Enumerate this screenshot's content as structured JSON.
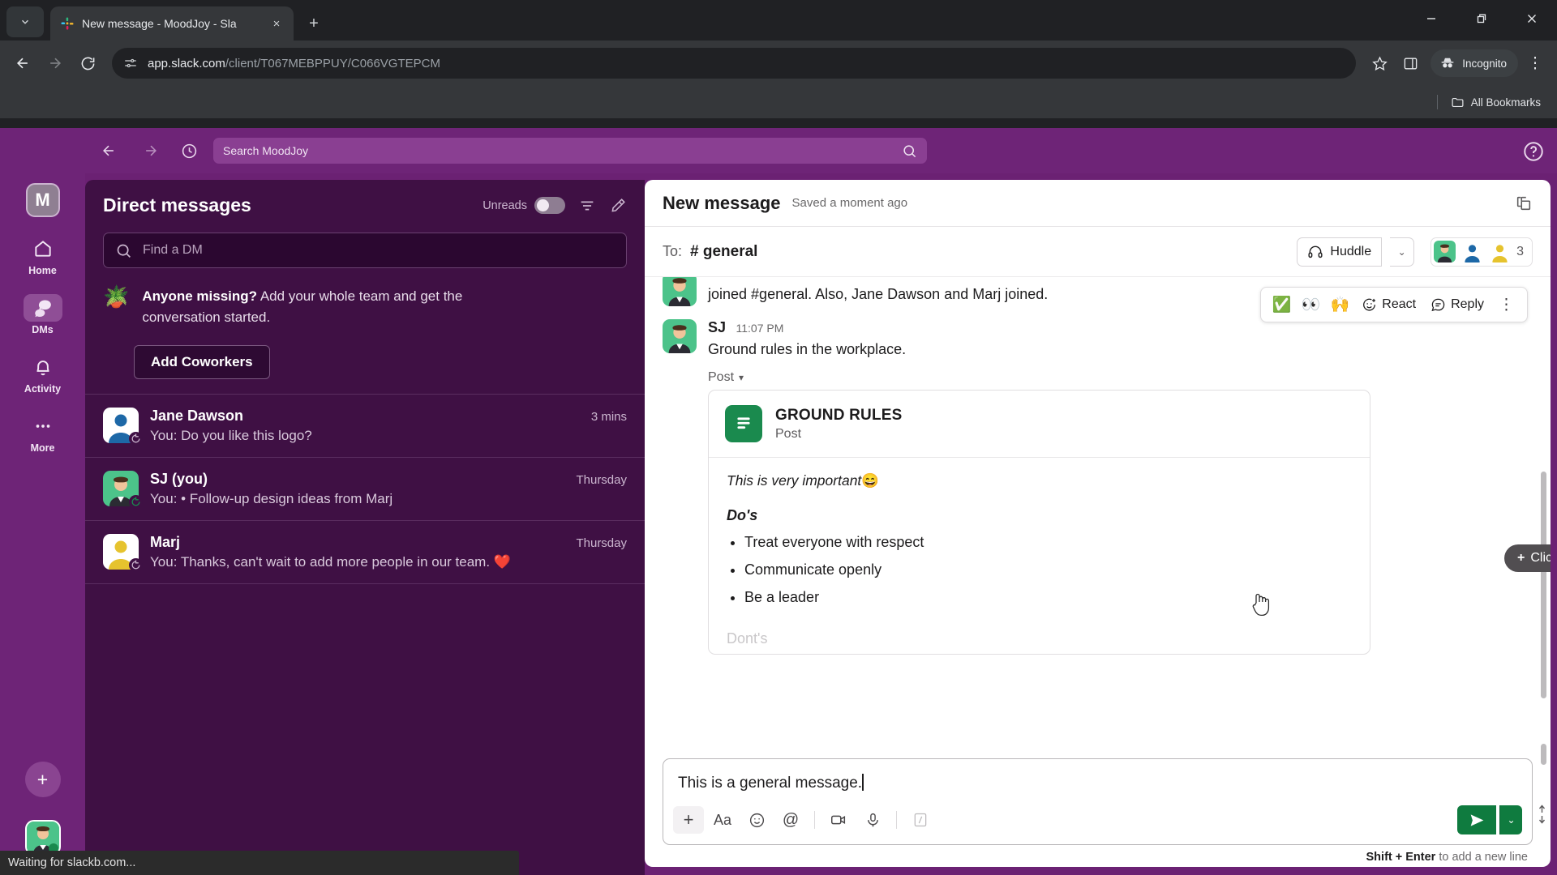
{
  "browser": {
    "tab": {
      "title": "New message - MoodJoy - Sla",
      "favicon": "slack-icon",
      "close": "×"
    },
    "tab_list_icon": "chevron-down-icon",
    "new_tab": "+",
    "window_controls": {
      "minimize": "—",
      "maximize": "❐",
      "close": "✕"
    },
    "nav": {
      "back": "←",
      "forward": "→",
      "reload": "↻"
    },
    "url_host": "app.slack.com",
    "url_path": "/client/T067MEBPPUY/C066VGTEPCM",
    "bookmark_star": "☆",
    "side_panel_icon": "side-panel-icon",
    "incognito_label": "Incognito",
    "menu_icon": "⋮",
    "bookmarks_label": "All Bookmarks"
  },
  "status_bar": {
    "text": "Waiting for slackb.com..."
  },
  "slack": {
    "topbar": {
      "back": "←",
      "forward": "→",
      "history_icon": "clock-icon",
      "search_placeholder": "Search MoodJoy",
      "search_icon": "search-icon",
      "help_icon": "help-circle-icon"
    },
    "rail": {
      "workspace_initial": "M",
      "items": [
        {
          "label": "Home",
          "icon": "home-icon",
          "active": false
        },
        {
          "label": "DMs",
          "icon": "dms-icon",
          "active": true
        },
        {
          "label": "Activity",
          "icon": "bell-icon",
          "active": false
        },
        {
          "label": "More",
          "icon": "ellipsis-icon",
          "active": false
        }
      ],
      "add_label": "+",
      "avatar": "user-avatar"
    },
    "sidebar": {
      "title": "Direct messages",
      "unreads_label": "Unreads",
      "unreads_on": false,
      "filter_icon": "filter-icon",
      "compose_icon": "compose-icon",
      "search_placeholder": "Find a DM",
      "promo": {
        "emoji": "🪴",
        "bold": "Anyone missing?",
        "rest": " Add your whole team and get the conversation started.",
        "button": "Add Coworkers"
      },
      "dms": [
        {
          "name": "Jane Dawson",
          "preview": "You: Do you like this logo?",
          "time": "3 mins",
          "avatar_color": "#1d68a7",
          "avatar_bg": "#ffffff"
        },
        {
          "name": "SJ (you)",
          "preview": "You: • Follow-up design ideas from Marj",
          "time": "Thursday",
          "avatar_color": "#3b2b1d",
          "avatar_bg": "#4cc38a"
        },
        {
          "name": "Marj",
          "preview": "You: Thanks, can't wait to add more people in our team. ❤️",
          "time": "Thursday",
          "avatar_color": "#e6c32e",
          "avatar_bg": "#ffffff"
        }
      ]
    },
    "main": {
      "header": {
        "title": "New message",
        "subtitle": "Saved a moment ago",
        "expand_icon": "open-in-new-icon"
      },
      "to_row": {
        "to_label": "To:",
        "channel": "# general",
        "huddle_label": "Huddle",
        "huddle_icon": "headphones-icon",
        "huddle_caret": "⌄",
        "member_count": "3"
      },
      "messages": [
        {
          "name": "",
          "time": "",
          "text": "joined #general. Also, Jane Dawson and Marj joined.",
          "clipped": true
        },
        {
          "name": "SJ",
          "time": "11:07 PM",
          "text": "Ground rules in the workplace.",
          "clipped": false
        }
      ],
      "hover_toolbar": {
        "emojis": [
          "✅",
          "👀",
          "🙌"
        ],
        "react_label": "React",
        "react_icon": "add-reaction-icon",
        "reply_label": "Reply",
        "reply_icon": "reply-icon",
        "more_icon": "⋮"
      },
      "post_chip": {
        "label": "Post",
        "caret": "▾"
      },
      "card": {
        "icon": "post-doc-icon",
        "title": "GROUND RULES",
        "subtitle": "Post",
        "intro": "This is very important",
        "intro_emoji": "😄",
        "section_do": "Do's",
        "do_items": [
          "Treat everyone with respect",
          "Communicate openly",
          "Be a leader"
        ],
        "section_dont": "Dont's"
      },
      "tooltip": {
        "plus": "+",
        "text": "Click to expand inline"
      },
      "composer": {
        "value": "This is a general message.",
        "tools": [
          {
            "icon": "plus-icon",
            "glyph": "+"
          },
          {
            "icon": "format-text-icon",
            "glyph": "Aa"
          },
          {
            "icon": "emoji-icon",
            "glyph": "☺"
          },
          {
            "icon": "mention-icon",
            "glyph": "@"
          },
          {
            "icon": "video-icon",
            "glyph": "video"
          },
          {
            "icon": "microphone-icon",
            "glyph": "mic"
          },
          {
            "icon": "slash-command-icon",
            "glyph": "slash"
          }
        ],
        "send_icon": "send-icon",
        "send_caret": "⌄",
        "hint_bold": "Shift + Enter",
        "hint_rest": " to add a new line"
      }
    }
  },
  "colors": {
    "slack_purple": "#6e2477",
    "sidebar_purple": "#3f1044",
    "accent_green": "#0f7b3f",
    "card_green": "#1a8a4e"
  }
}
